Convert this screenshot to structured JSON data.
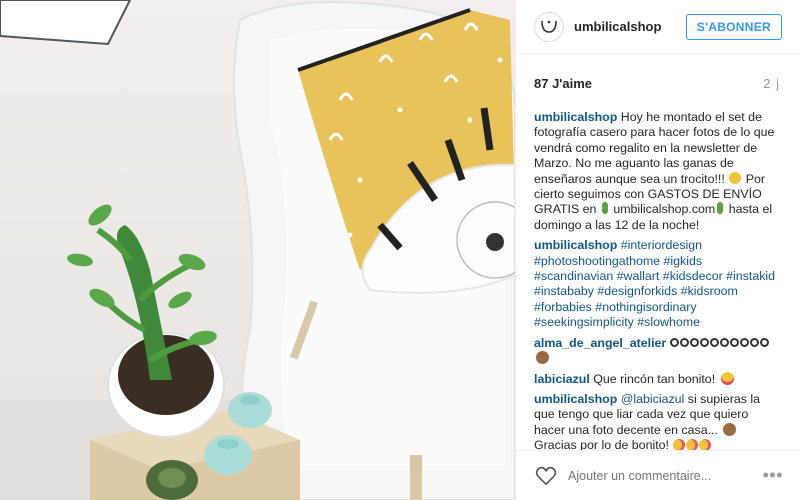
{
  "post": {
    "username": "umbilicalshop",
    "follow_label": "S'ABONNER",
    "likes": "87 J'aime",
    "time": "2 j"
  },
  "caption": {
    "user": "umbilicalshop",
    "text1": " Hoy he montado el set de fotografía casero para hacer fotos de lo que vendrá como regalito en la newsletter de Marzo. No me aguanto las ganas de enseñaros aunque sea un trocito!!! ",
    "text2": " Por cierto seguimos con GASTOS DE ENVÍO GRATIS en ",
    "text3": " umbilicalshop.com",
    "text4": " hasta el domingo a las 12 de la noche!"
  },
  "hashtags": {
    "user": "umbilicalshop",
    "tags": "#interiordesign #photoshootingathome #igkids #scandinavian #wallart #kidsdecor #instakid #instababy #designforkids #kidsroom #forbabies #nothingisordinary #seekingsimplicity #slowhome"
  },
  "comments": [
    {
      "user": "alma_de_angel_atelier",
      "text": " "
    },
    {
      "user": "labiciazul",
      "text": " Que rincón tan bonito! "
    },
    {
      "user": "umbilicalshop",
      "mention": "@labiciazul",
      "text": " si supieras la que tengo que liar cada vez que quiero hacer una foto decente en casa... ",
      "text2": " Gracias por lo de bonito! "
    }
  ],
  "footer": {
    "placeholder": "Ajouter un commentaire...",
    "more": "•••"
  },
  "colors": {
    "link": "#125688",
    "follow": "#3897f0",
    "pillow": "#e8c35a"
  },
  "icons": {
    "avatar": "umbilical-logo-icon",
    "like": "heart-outline-icon",
    "options": "more-options-icon"
  }
}
